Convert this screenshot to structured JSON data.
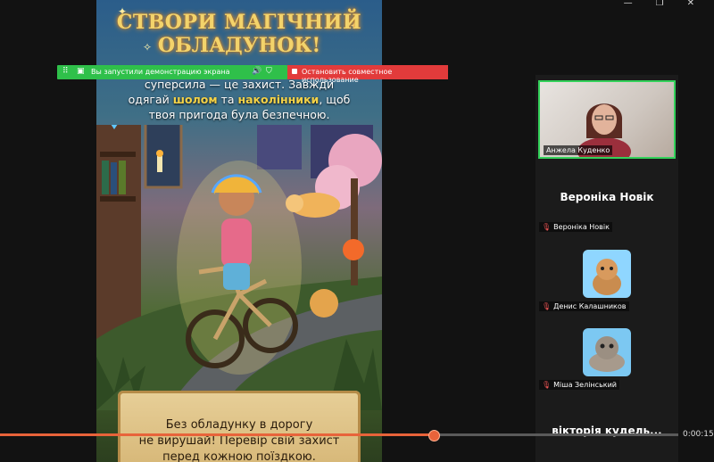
{
  "window_controls": [
    "—",
    "❐",
    "✕"
  ],
  "slide": {
    "title_line1": "СТВОРИ МАГІЧНИЙ",
    "title_line2": "ОБЛАДУНОК!",
    "body_line1": "суперсила — це захист. Завжди",
    "body_line2_pre": "одягай ",
    "body_line2_hl1": "шолом",
    "body_line2_mid": " та ",
    "body_line2_hl2": "наколінники",
    "body_line2_post": ", щоб",
    "body_line3": "твоя пригода була безпечною.",
    "scroll_line1": "Без обладунку в дорогу",
    "scroll_line2": "не вирушай! Перевір свій захист",
    "scroll_line3": "перед кожною поїздкою."
  },
  "share": {
    "status_label": "Вы запустили демонстрацию экрана",
    "stop_label": "Остановить совместное использование"
  },
  "participants": {
    "main_video_name": "Анжела Куденко",
    "p1_big": "Вероніка Новік",
    "p1_tag": "Вероніка Новік",
    "p2_tag": "Денис Калашников",
    "p3_tag": "Міша Зелінський",
    "p4_big": "вікторія кудель..."
  },
  "playback": {
    "time": "0:00:15",
    "progress_fraction": 0.64
  },
  "colors": {
    "accent": "#e8633a",
    "share_green": "#2fc04a",
    "share_red": "#e23b3b",
    "active_border": "#33d15a",
    "highlight": "#f4d248"
  }
}
